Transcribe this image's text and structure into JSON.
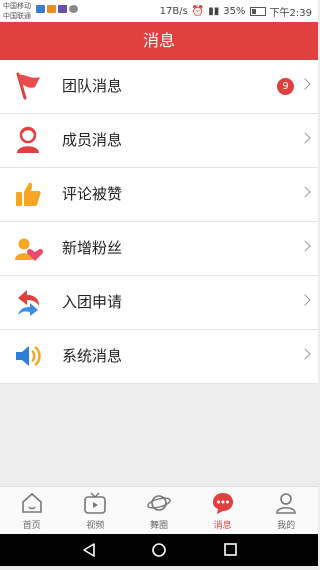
{
  "status_bar": {
    "carrier_1": "中国移动",
    "carrier_2": "中国联通",
    "speed": "17B/s",
    "battery": "35%",
    "time": "下午2:39"
  },
  "header": {
    "title": "消息"
  },
  "menu": [
    {
      "label": "团队消息",
      "icon": "red-flag-icon",
      "badge": "9"
    },
    {
      "label": "成员消息",
      "icon": "member-icon"
    },
    {
      "label": "评论被赞",
      "icon": "thumbs-up-icon"
    },
    {
      "label": "新增粉丝",
      "icon": "new-fans-icon"
    },
    {
      "label": "入团申请",
      "icon": "join-request-icon"
    },
    {
      "label": "系统消息",
      "icon": "speaker-icon"
    }
  ],
  "tabs": [
    {
      "label": "首页",
      "icon": "home-icon"
    },
    {
      "label": "视频",
      "icon": "tv-icon"
    },
    {
      "label": "舞圈",
      "icon": "planet-icon"
    },
    {
      "label": "消息",
      "icon": "chat-bubble-icon",
      "active": true
    },
    {
      "label": "我的",
      "icon": "user-icon"
    }
  ],
  "colors": {
    "accent": "#e0403f",
    "background": "#ededed"
  }
}
